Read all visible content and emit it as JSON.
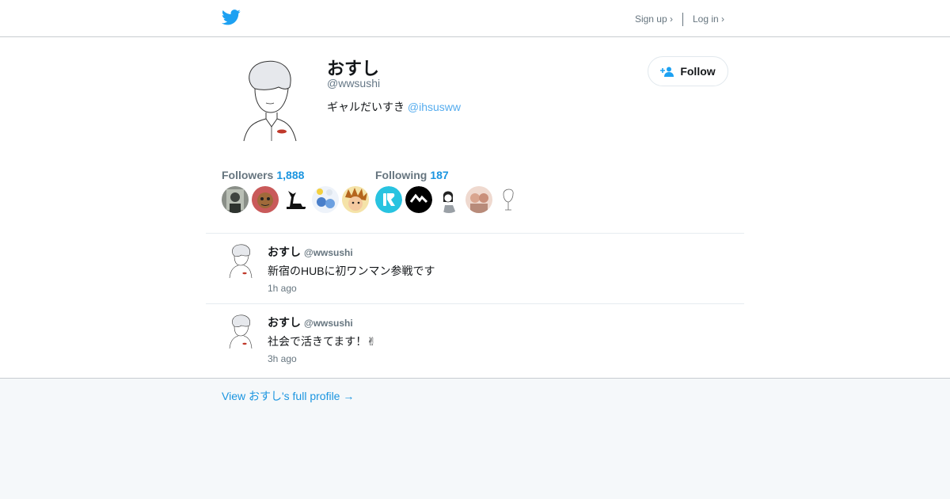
{
  "header": {
    "logo_icon": "twitter-bird-icon",
    "signup_label": "Sign up ›",
    "login_label": "Log in ›",
    "brand_color": "#1da1f2"
  },
  "profile": {
    "name": "おすし",
    "handle": "@wwsushi",
    "bio_text": "ギャルだいすき ",
    "bio_mention": "@ihsusww",
    "follow_label": "Follow",
    "follow_icon": "add-user-icon",
    "followers_label": "Followers",
    "followers_count": "1,888",
    "following_label": "Following",
    "following_count": "187"
  },
  "tweets": [
    {
      "name": "おすし",
      "handle": "@wwsushi",
      "text": "新宿のHUBに初ワンマン参戦です",
      "time": "1h ago"
    },
    {
      "name": "おすし",
      "handle": "@wwsushi",
      "text": "社会で活きてます！✌",
      "time": "3h ago"
    }
  ],
  "footer": {
    "full_profile_link": "View おすし's full profile →"
  },
  "colors": {
    "link": "#1b95e0",
    "mention": "#55acee",
    "muted": "#66757f",
    "footer_bg": "#f5f8fa"
  }
}
